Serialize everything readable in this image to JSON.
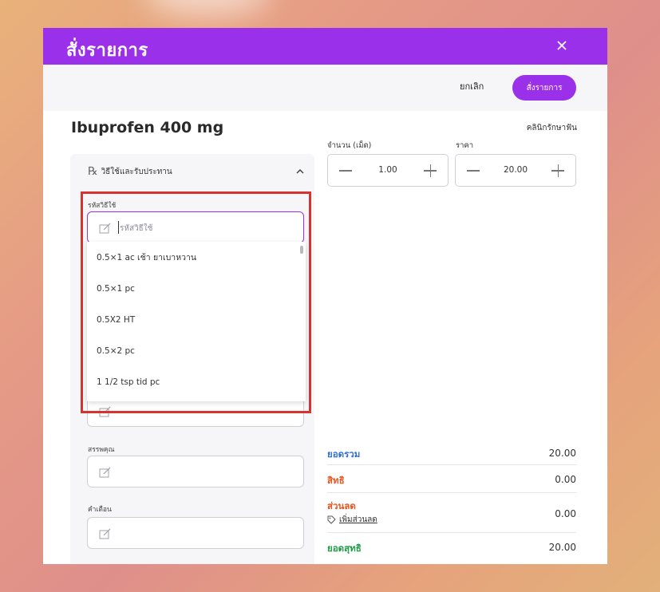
{
  "modal": {
    "title": "สั่งรายการ",
    "close_label": "×",
    "cancel_label": "ยกเลิก",
    "order_label": "สั่งรายการ"
  },
  "product": {
    "name": "Ibuprofen 400 mg",
    "clinic": "คลินิกรักษาฟัน"
  },
  "usage": {
    "section_label": "วิธีใช้และรับประทาน",
    "code_label": "รหัสวิธีใช้",
    "code_placeholder": "รหัสวิธีใช้",
    "options": [
      "0.5×1 ac เช้า ยาเบาหวาน",
      "0.5×1 pc",
      "0.5X2 HT",
      "0.5×2 pc",
      "1 1/2 tsp tid pc"
    ],
    "properties_label": "สรรพคุณ",
    "warning_label": "คำเตือน"
  },
  "quantity": {
    "label": "จำนวน (เม็ด)",
    "value": "1.00",
    "price_label": "ราคา",
    "price_value": "20.00"
  },
  "summary": {
    "total_label": "ยอดรวม",
    "total_value": "20.00",
    "rights_label": "สิทธิ",
    "rights_value": "0.00",
    "discount_label": "ส่วนลด",
    "discount_value": "0.00",
    "add_discount_label": "เพิ่มส่วนลด",
    "net_label": "ยอดสุทธิ",
    "net_value": "20.00"
  },
  "colors": {
    "brand": "#9b30ea",
    "total": "#2f6fd1",
    "rights": "#e8541c",
    "discount": "#e8541c",
    "net": "#1e9b47",
    "highlight": "#d6322e"
  }
}
